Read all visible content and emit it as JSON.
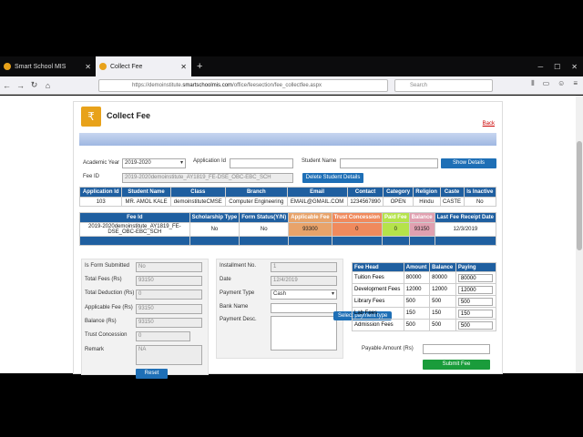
{
  "browser": {
    "tabs": [
      {
        "label": "Smart School MIS"
      },
      {
        "label": "Collect Fee"
      }
    ],
    "url_prefix": "https://demoinstitute.",
    "url_host": "smartschoolmis.com",
    "url_path": "/office/feesection/fee_collectfee.aspx",
    "search_placeholder": "Search"
  },
  "page": {
    "title": "Collect Fee",
    "back": "Back",
    "academic_year_label": "Academic Year",
    "academic_year": "2019-2020",
    "application_id_label": "Application Id",
    "student_name_label": "Student Name",
    "show_details": "Show Details",
    "fee_id_label": "Fee ID",
    "fee_id": "2019-2020demoinstitute_AY1819_FE-DSE_OBC-EBC_SCH",
    "delete_details": "Delete Student Details"
  },
  "student_table": {
    "headers": [
      "Application Id",
      "Student Name",
      "Class",
      "Branch",
      "Email",
      "Contact",
      "Category",
      "Religion",
      "Caste",
      "Is Inactive"
    ],
    "row": [
      "103",
      "MR. AMOL KALE",
      "demoinstituteCMSE",
      "Computer Engineering",
      "EMAIL@GMAIL.COM",
      "1234567890",
      "OPEN",
      "Hindu",
      "CASTE",
      "No"
    ]
  },
  "fee_table": {
    "headers": [
      "Fee Id",
      "Scholarship Type",
      "Form Status(Y/N)",
      "Applicable Fee",
      "Trust Concession",
      "Paid Fee",
      "Balance",
      "Last Fee Receipt Date"
    ],
    "row": [
      "2019-2020demoinstitute_AY1819_FE-DSE_OBC-EBC_SCH",
      "No",
      "No",
      "93300",
      "0",
      "0",
      "93150",
      "12/3/2019"
    ]
  },
  "summary": {
    "form_submitted_label": "Is Form Submitted",
    "form_submitted": "No",
    "total_fees_label": "Total Fees (Rs)",
    "total_fees": "93150",
    "total_deduction_label": "Total Deduction (Rs)",
    "total_deduction": "0",
    "applicable_fee_label": "Applicable Fee (Rs)",
    "applicable_fee": "93150",
    "balance_label": "Balance (Rs)",
    "balance": "93150",
    "trust_concession_label": "Trust Concession",
    "trust_concession": "0",
    "remark_label": "Remark",
    "remark": "NA",
    "reset": "Reset"
  },
  "installment": {
    "no_label": "Installment No.",
    "no": "1",
    "date_label": "Date",
    "date": "12/4/2019",
    "payment_type_label": "Payment Type",
    "payment_type": "Cash",
    "bank_name_label": "Bank Name",
    "payment_desc_label": "Payment Desc.",
    "tooltip": "Select payment type"
  },
  "fee_heads": {
    "headers": [
      "Fee Head",
      "Amount",
      "Balance",
      "Paying"
    ],
    "rows": [
      [
        "Tuition Fees",
        "80000",
        "80000",
        "80000"
      ],
      [
        "Development Fees",
        "12000",
        "12000",
        "12000"
      ],
      [
        "Library Fees",
        "500",
        "500",
        "500"
      ],
      [
        "Lab Fees",
        "150",
        "150",
        "150"
      ],
      [
        "Admission Fees",
        "500",
        "500",
        "500"
      ]
    ]
  },
  "payable": {
    "label": "Payable Amount (Rs)",
    "submit": "Submit Fee"
  },
  "colors": {
    "applicable_bg": "#e8a36a",
    "trust_bg": "#f08a5d",
    "paid_bg": "#b5e34a",
    "balance_bg": "#e0a0b0",
    "header_blue": "#1f5fa0"
  }
}
